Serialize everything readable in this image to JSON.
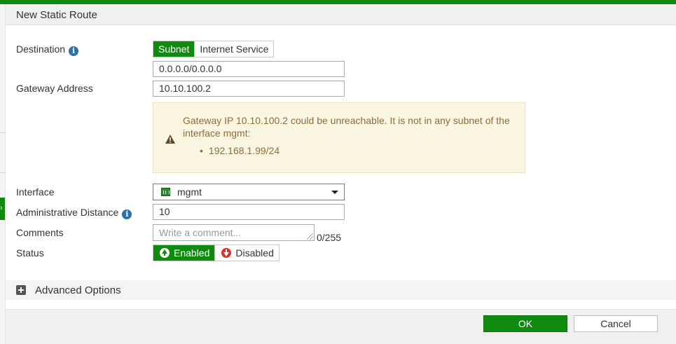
{
  "dialog": {
    "title": "New Static Route"
  },
  "destination": {
    "label": "Destination",
    "info_icon": "info-icon",
    "type_options": [
      "Subnet",
      "Internet Service"
    ],
    "selected_type": "Subnet",
    "value": "0.0.0.0/0.0.0.0"
  },
  "gateway": {
    "label": "Gateway Address",
    "value": "10.10.100.2"
  },
  "warning": {
    "icon": "warning-triangle-icon",
    "message": "Gateway IP 10.10.100.2 could be unreachable. It is not in any subnet of the interface mgmt:",
    "subnets": [
      "192.168.1.99/24"
    ],
    "color": "#8a6d3b",
    "background": "#fbf6e2"
  },
  "interface": {
    "label": "Interface",
    "icon": "network-port-icon",
    "value": "mgmt"
  },
  "admin_distance": {
    "label": "Administrative Distance",
    "info_icon": "info-icon",
    "value": "10"
  },
  "comments": {
    "label": "Comments",
    "placeholder": "Write a comment...",
    "counter": "0/255"
  },
  "status": {
    "label": "Status",
    "options": [
      {
        "label": "Enabled",
        "icon": "arrow-up-circle-icon"
      },
      {
        "label": "Disabled",
        "icon": "arrow-down-circle-icon"
      }
    ],
    "selected": "Enabled"
  },
  "advanced": {
    "label": "Advanced Options",
    "icon": "plus-box-icon"
  },
  "footer": {
    "ok_label": "OK",
    "cancel_label": "Cancel"
  },
  "colors": {
    "accent": "#0e8a0e",
    "info": "#2e6faa",
    "danger": "#d9302b"
  }
}
